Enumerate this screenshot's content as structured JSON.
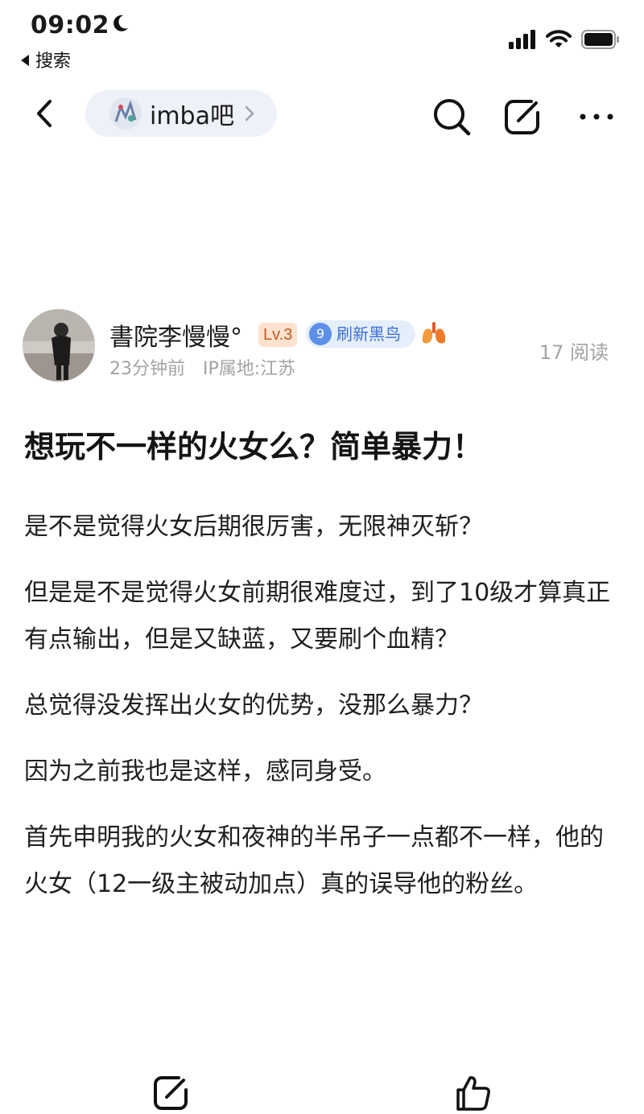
{
  "status_bar": {
    "time": "09:02",
    "back_app_label": "搜索"
  },
  "navbar": {
    "forum_name": "imba吧"
  },
  "author": {
    "name": "書院李慢慢°",
    "level": "Lv.3",
    "badge_number": "9",
    "badge_label": "刷新黑鸟",
    "time_ago": "23分钟前",
    "ip_location": "IP属地:江苏",
    "views": "17 阅读"
  },
  "post": {
    "title": "想玩不一样的火女么？简单暴力！",
    "paragraphs": [
      "是不是觉得火女后期很厉害，无限神灭斩？",
      "但是是不是觉得火女前期很难度过，到了10级才算真正有点输出，但是又缺蓝，又要刷个血精？",
      "总觉得没发挥出火女的优势，没那么暴力？",
      "因为之前我也是这样，感同身受。",
      "首先申明我的火女和夜神的半吊子一点都不一样，他的火女（12一级主被动加点）真的误导他的粉丝。"
    ]
  },
  "colors": {
    "badge_blue": "#5b8fe8",
    "level_orange": "#c2591f",
    "meta_gray": "#a3a3a3",
    "pill_bg": "#eef1f8"
  },
  "icons": [
    "moon-icon",
    "signal-icon",
    "wifi-icon",
    "battery-icon",
    "back-arrow-icon",
    "chevron-right-icon",
    "search-icon",
    "edit-icon",
    "more-icon",
    "lung-icon",
    "comment-edit-icon",
    "thumbs-up-icon"
  ]
}
